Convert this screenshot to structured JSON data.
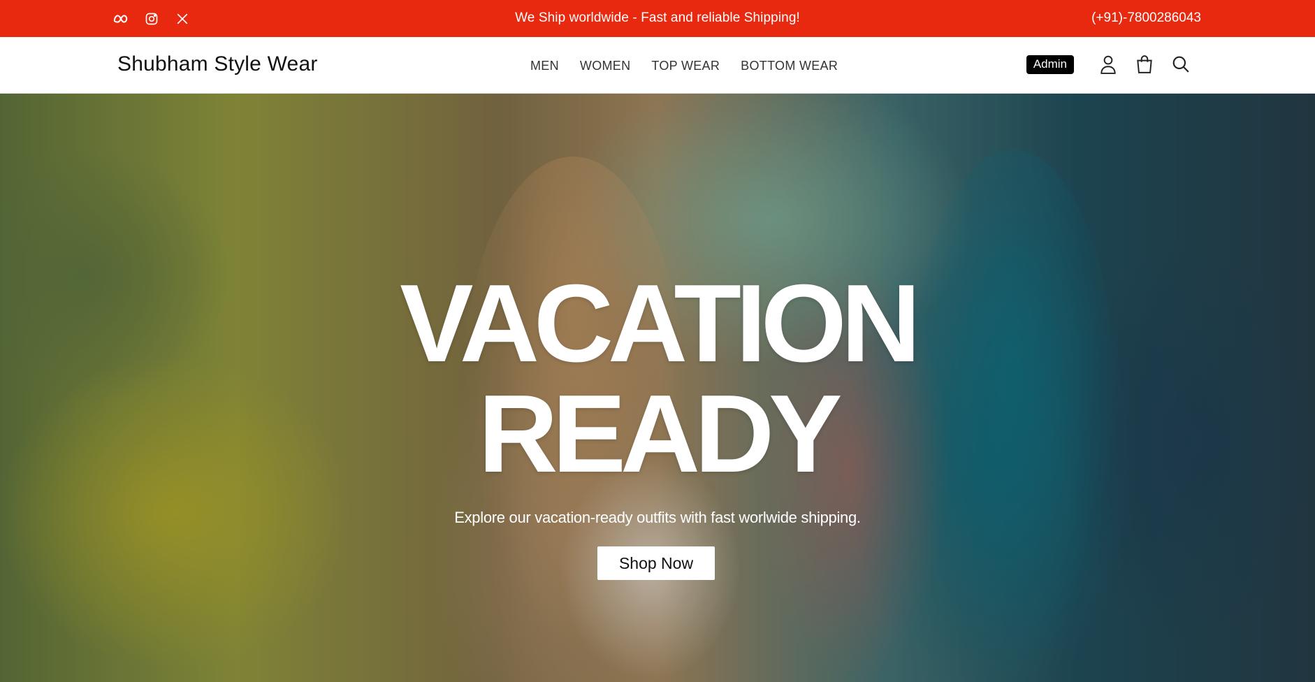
{
  "topbar": {
    "socials": [
      {
        "name": "meta-icon"
      },
      {
        "name": "instagram-icon"
      },
      {
        "name": "x-twitter-icon"
      }
    ],
    "announcement": "We Ship worldwide - Fast and reliable Shipping!",
    "phone": "(+91)-7800286043",
    "bg_color": "#e8290f"
  },
  "header": {
    "brand": "Shubham Style Wear",
    "nav": [
      "MEN",
      "WOMEN",
      "TOP WEAR",
      "BOTTOM WEAR"
    ],
    "admin_label": "Admin",
    "icons": [
      "user-icon",
      "shopping-bag-icon",
      "search-icon"
    ]
  },
  "hero": {
    "title_line1": "VACATION",
    "title_line2": "READY",
    "subtitle": "Explore our vacation-ready outfits with fast worlwide shipping.",
    "cta_label": "Shop Now"
  }
}
